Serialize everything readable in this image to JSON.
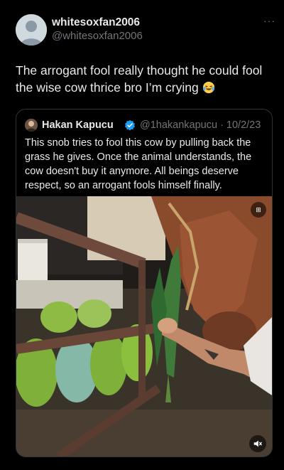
{
  "post": {
    "author_name": "whitesoxfan2006",
    "author_handle": "@whitesoxfan2006",
    "more_label": "···",
    "text": "The arrogant fool really thought he could fool the wise cow thrice bro I’m crying",
    "emoji_icon": "laughing-crying-emoji-icon"
  },
  "quote": {
    "author_name": "Hakan Kapucu",
    "verified_icon": "verified-badge-icon",
    "handle_and_date": "@1hakankapucu · 10/2/23",
    "text": "This snob tries to fool this cow by pulling back the grass he gives. Once the animal understands, the cow doesn't buy it anymore. All beings deserve respect, so an arrogant fools himself finally.",
    "media": {
      "alt_badge": "⊞",
      "mute_icon": "speaker-mute-icon"
    }
  },
  "colors": {
    "background": "#000000",
    "text": "#e7e9ea",
    "secondary_text": "#71767b",
    "border": "#2f3336",
    "verified_blue": "#1d9bf0"
  }
}
